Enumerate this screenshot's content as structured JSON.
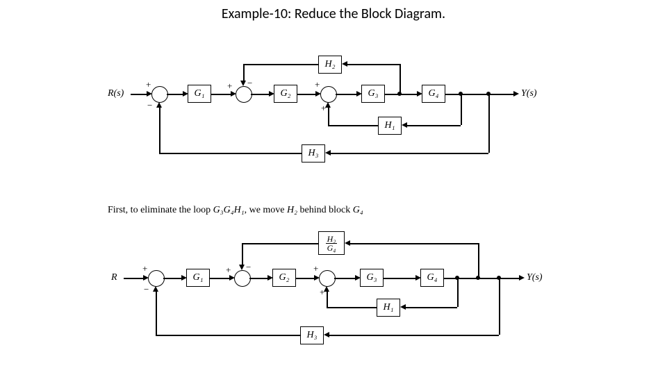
{
  "title": "Example-10: Reduce the Block Diagram.",
  "body_text_parts": {
    "p1": "First, to eliminate the loop ",
    "loop": "G₃G₄H₁",
    "p2": ", we move ",
    "h2": "H₂",
    "p3": " behind block ",
    "g4": "G₄"
  },
  "diagram1": {
    "input": "R(s)",
    "output": "Y(s)",
    "blocks": {
      "G1": "G₁",
      "G2": "G₂",
      "G3": "G₃",
      "G4": "G₄",
      "H1": "H₁",
      "H2": "H₂",
      "H3": "H₃"
    },
    "signs": {
      "s1p": "+",
      "s1m": "−",
      "s2p": "+",
      "s2m": "−",
      "s3p": "+",
      "s3p2": "+"
    }
  },
  "diagram2": {
    "input": "R",
    "output": "Y(s)",
    "blocks": {
      "G1": "G₁",
      "G2": "G₂",
      "G3": "G₃",
      "G4": "G₄",
      "H1": "H₁",
      "H3": "H₃",
      "H2overG4_num": "H₂",
      "H2overG4_den": "G₄"
    },
    "signs": {
      "s1p": "+",
      "s1m": "−",
      "s2p": "+",
      "s2m": "−",
      "s3p": "+",
      "s3p2": "+"
    }
  }
}
